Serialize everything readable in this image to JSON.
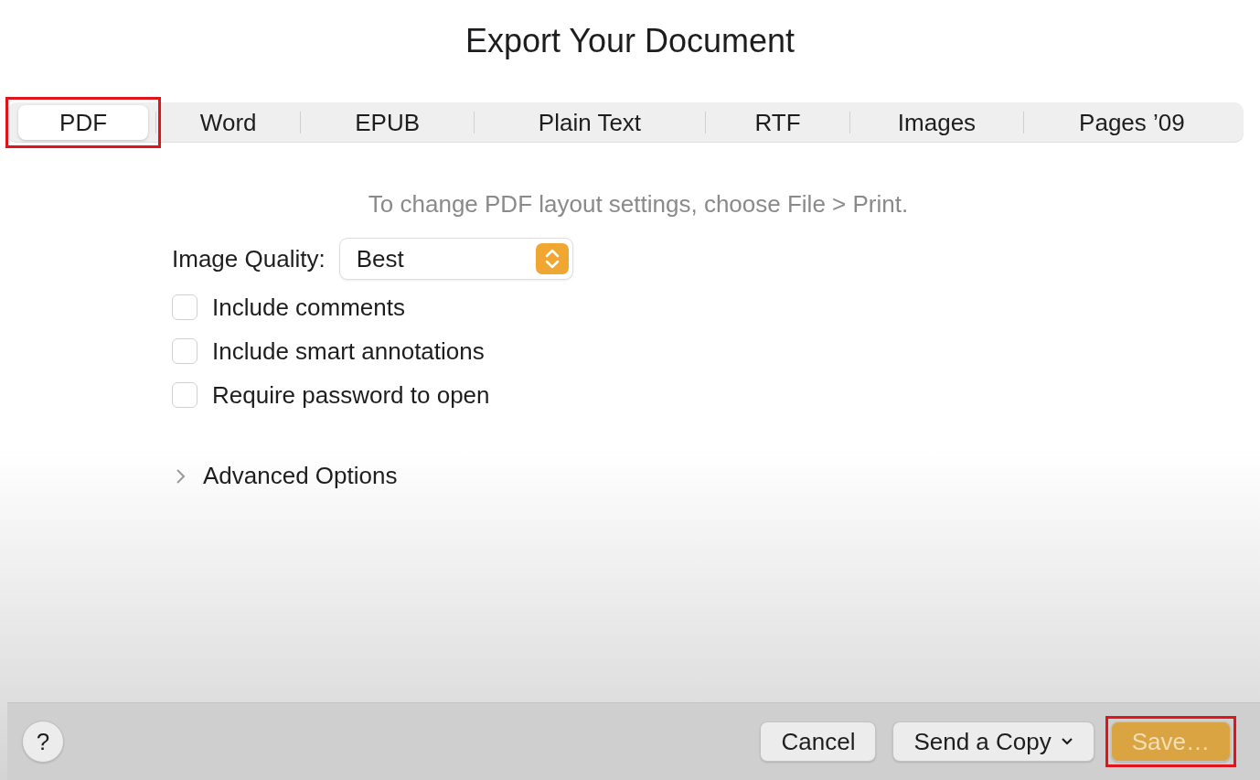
{
  "window": {
    "title": "Export Your Document"
  },
  "tabs": [
    {
      "label": "PDF",
      "selected": true,
      "highlighted": true
    },
    {
      "label": "Word",
      "selected": false,
      "highlighted": false
    },
    {
      "label": "EPUB",
      "selected": false,
      "highlighted": false
    },
    {
      "label": "Plain Text",
      "selected": false,
      "highlighted": false
    },
    {
      "label": "RTF",
      "selected": false,
      "highlighted": false
    },
    {
      "label": "Images",
      "selected": false,
      "highlighted": false
    },
    {
      "label": "Pages ’09",
      "selected": false,
      "highlighted": false
    }
  ],
  "note": "To change PDF layout settings, choose File > Print.",
  "image_quality": {
    "label": "Image Quality:",
    "value": "Best"
  },
  "options": [
    {
      "label": "Include comments",
      "checked": false
    },
    {
      "label": "Include smart annotations",
      "checked": false
    },
    {
      "label": "Require password to open",
      "checked": false
    }
  ],
  "advanced": {
    "label": "Advanced Options",
    "expanded": false
  },
  "footer": {
    "help": "?",
    "buttons": [
      {
        "kind": "plain",
        "label": "Cancel",
        "disabled": false,
        "highlighted": false
      },
      {
        "kind": "menu",
        "label": "Send a Copy",
        "disabled": false,
        "highlighted": false
      },
      {
        "kind": "default",
        "label": "Save…",
        "disabled": true,
        "highlighted": true
      }
    ]
  }
}
